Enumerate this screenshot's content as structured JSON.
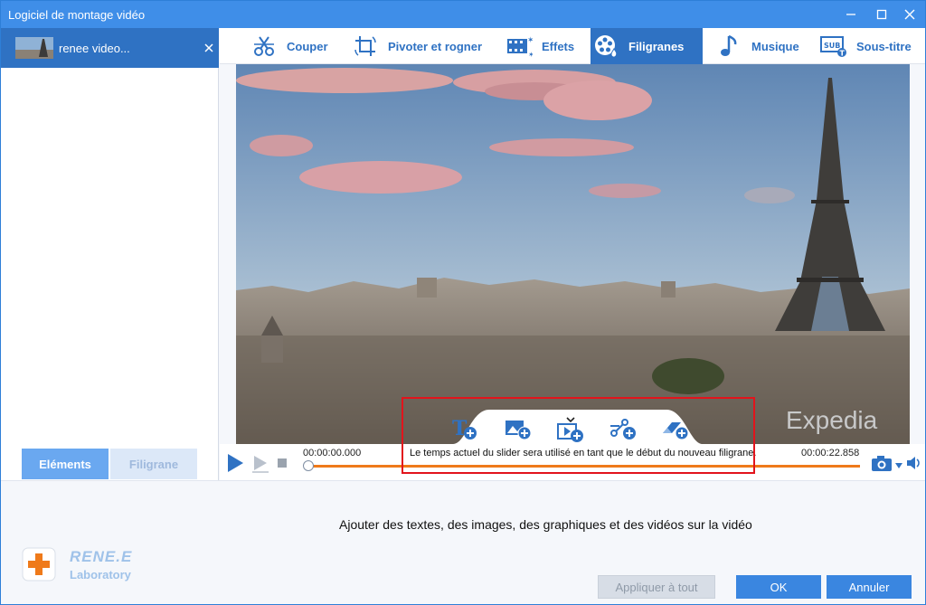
{
  "window": {
    "title": "Logiciel de montage vidéo"
  },
  "file_list": {
    "items": [
      {
        "name": "renee video..."
      }
    ]
  },
  "left_tabs": [
    {
      "label": "Eléments",
      "active": true
    },
    {
      "label": "Filigrane",
      "active": false
    }
  ],
  "toolbar": {
    "items": [
      {
        "label": "Couper",
        "icon": "scissors-icon"
      },
      {
        "label": "Pivoter et rogner",
        "icon": "crop-rotate-icon"
      },
      {
        "label": "Effets",
        "icon": "effects-film-icon"
      },
      {
        "label": "Filigranes",
        "icon": "watermark-film-reel-icon",
        "active": true
      },
      {
        "label": "Musique",
        "icon": "music-note-icon"
      },
      {
        "label": "Sous-titre",
        "icon": "subtitle-icon"
      }
    ]
  },
  "video": {
    "watermark_text": "Expedia"
  },
  "watermark_tools": [
    {
      "icon": "add-text-icon"
    },
    {
      "icon": "add-image-icon"
    },
    {
      "icon": "add-video-icon"
    },
    {
      "icon": "add-shape-icon"
    },
    {
      "icon": "add-eraser-icon"
    }
  ],
  "player": {
    "time_start": "00:00:00.000",
    "time_end": "00:00:22.858",
    "hint": "Le temps actuel du slider sera utilisé en tant que le début du nouveau filigrane.",
    "progress": 0
  },
  "bottom": {
    "description": "Ajouter des textes, des images, des graphiques et des vidéos sur la vidéo",
    "apply_all_label": "Appliquer à tout",
    "ok_label": "OK",
    "cancel_label": "Annuler"
  },
  "logo": {
    "name": "RENE.E",
    "sub": "Laboratory"
  },
  "colors": {
    "accent": "#2f72c3",
    "titlebar": "#3f8ee8",
    "progress": "#ef7a1a",
    "highlight": "#e2141c"
  }
}
